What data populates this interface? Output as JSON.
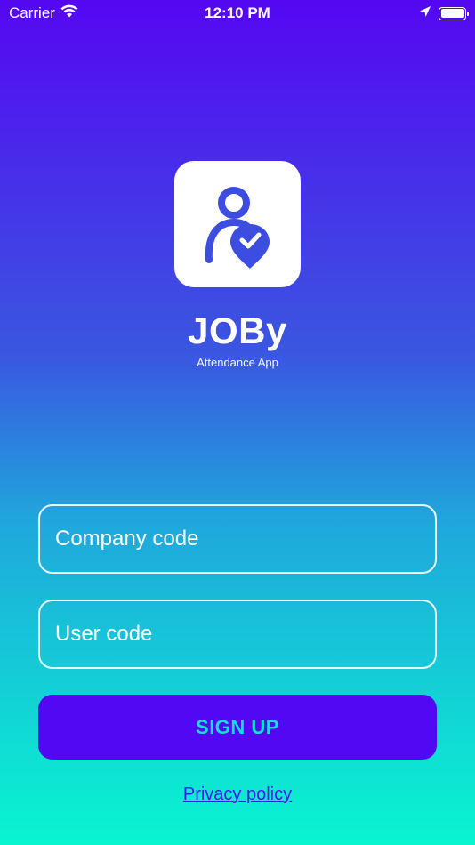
{
  "status_bar": {
    "carrier": "Carrier",
    "time": "12:10 PM",
    "icons": [
      "wifi-icon",
      "location-arrow-icon",
      "battery-icon"
    ]
  },
  "app": {
    "name": "JOBy",
    "tagline": "Attendance App",
    "logo_icon": "person-location-check-icon",
    "logo_color": "#3c4de0"
  },
  "form": {
    "company_code_placeholder": "Company code",
    "company_code_value": "",
    "user_code_placeholder": "User code",
    "user_code_value": "",
    "signup_label": "SIGN UP"
  },
  "footer": {
    "privacy_link": "Privacy policy"
  },
  "colors": {
    "gradient_top": "#5507f2",
    "gradient_bottom": "#09f5d0",
    "button_bg": "#5208f2",
    "button_text": "#11e0d6",
    "link_color": "#4418e8"
  }
}
